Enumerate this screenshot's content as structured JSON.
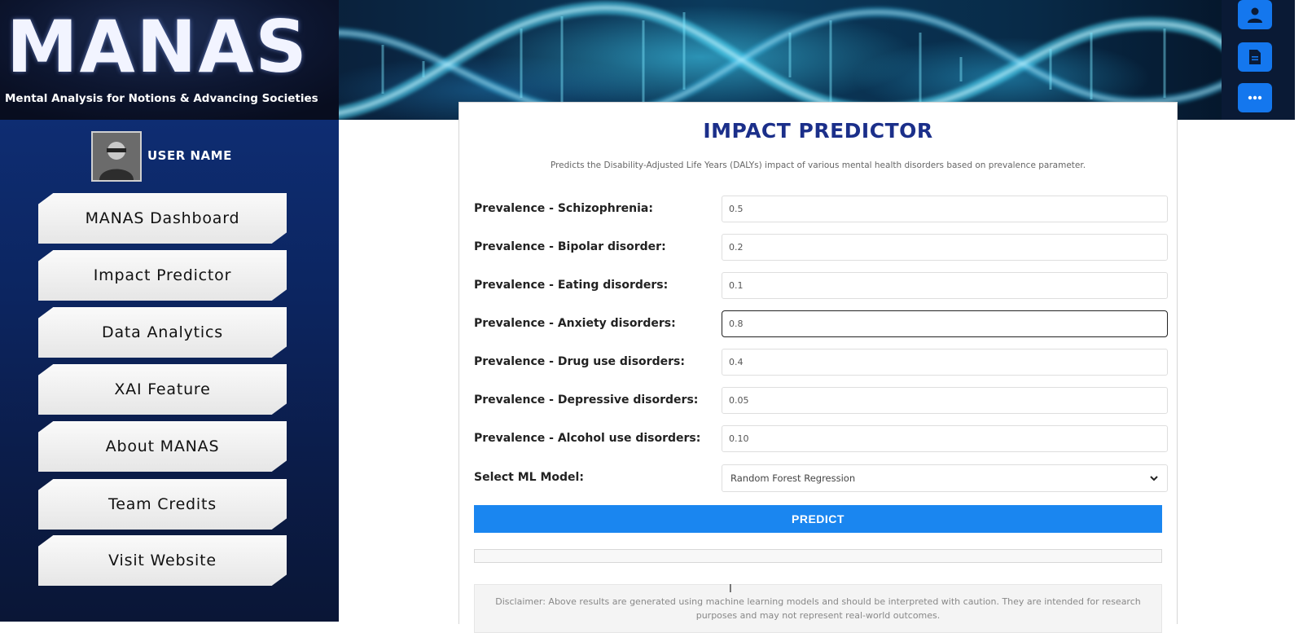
{
  "header": {
    "logo": "MANAS",
    "tagline": "Mental Analysis for Notions & Advancing Societies"
  },
  "rail": {
    "icons": [
      "user-icon",
      "document-icon",
      "chat-icon"
    ]
  },
  "sidebar": {
    "user_name": "USER NAME",
    "items": [
      {
        "label": "MANAS Dashboard"
      },
      {
        "label": "Impact Predictor"
      },
      {
        "label": "Data Analytics"
      },
      {
        "label": "XAI Feature"
      },
      {
        "label": "About MANAS"
      },
      {
        "label": "Team Credits"
      },
      {
        "label": "Visit Website"
      }
    ]
  },
  "main": {
    "title": "IMPACT PREDICTOR",
    "description": "Predicts the Disability-Adjusted Life Years (DALYs) impact of various mental health disorders based on prevalence parameter.",
    "fields": [
      {
        "label": "Prevalence - Schizophrenia:",
        "value": "0.5"
      },
      {
        "label": "Prevalence - Bipolar disorder:",
        "value": "0.2"
      },
      {
        "label": "Prevalence - Eating disorders:",
        "value": "0.1"
      },
      {
        "label": "Prevalence - Anxiety disorders:",
        "value": "0.8"
      },
      {
        "label": "Prevalence - Drug use disorders:",
        "value": "0.4"
      },
      {
        "label": "Prevalence - Depressive disorders:",
        "value": "0.05"
      },
      {
        "label": "Prevalence - Alcohol use disorders:",
        "value": "0.10"
      }
    ],
    "model_label": "Select ML Model:",
    "model_selected": "Random Forest Regression",
    "predict_label": "PREDICT",
    "disclaimer": "Disclaimer: Above results are generated using machine learning models and should be interpreted with caution. They are intended for research purposes and may not represent real-world outcomes."
  },
  "colors": {
    "accent": "#1a86f0",
    "title": "#1b2f8a",
    "sidebar": "#0c2560"
  }
}
